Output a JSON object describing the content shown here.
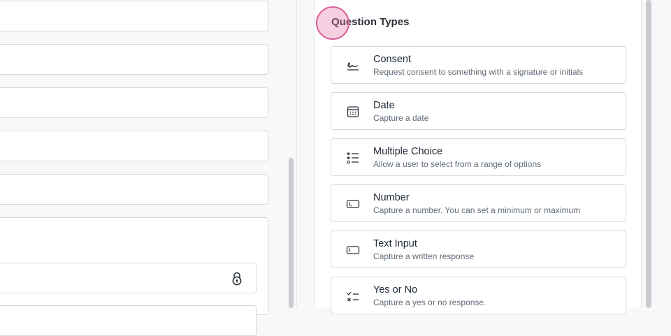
{
  "panel": {
    "title": "Question Types"
  },
  "question_types": [
    {
      "label": "Consent",
      "description": "Request consent to something with a signature or initials",
      "icon": "signature-icon"
    },
    {
      "label": "Date",
      "description": "Capture a date",
      "icon": "calendar-icon"
    },
    {
      "label": "Multiple Choice",
      "description": "Allow a user to select from a range of options",
      "icon": "list-icon"
    },
    {
      "label": "Number",
      "description": "Capture a number. You can set a minimum or maximum",
      "icon": "number-field-icon"
    },
    {
      "label": "Text Input",
      "description": "Capture a written response",
      "icon": "text-field-icon"
    },
    {
      "label": "Yes or No",
      "description": "Capture a yes or no response.",
      "icon": "yes-no-icon"
    }
  ],
  "colors": {
    "accent_ring": "#d9619a",
    "card_border": "#d6dade"
  }
}
